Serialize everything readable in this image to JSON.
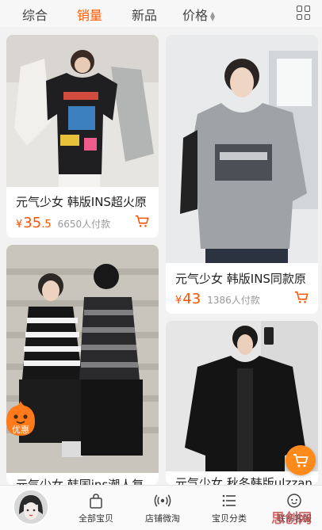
{
  "sort_bar": {
    "tabs": [
      "综合",
      "销量",
      "新品",
      "价格"
    ],
    "active_tab": "销量"
  },
  "products": [
    {
      "title": "元气少女 韩版INS超火原",
      "currency": "¥",
      "price_int": "35",
      "price_dec": ".5",
      "sold": "6650人付款"
    },
    {
      "title": "元气少女 韩版INS同款原",
      "currency": "¥",
      "price_int": "43",
      "price_dec": "",
      "sold": "1386人付款"
    },
    {
      "title": "元气少女 韩国ins潮人复",
      "currency": "",
      "price_int": "",
      "price_dec": "",
      "sold": ""
    },
    {
      "title": "元气少女 秋冬韩版ulzzan",
      "currency": "",
      "price_int": "",
      "price_dec": "",
      "sold": ""
    }
  ],
  "promo_badge": "优惠",
  "tab_bar": {
    "items": [
      "全部宝贝",
      "店铺微淘",
      "宝贝分类",
      "联系客服"
    ]
  },
  "watermark": "思创网",
  "colors": {
    "accent": "#ff5000",
    "active_tab": "#ff5a00",
    "fab": "#ff8a1c"
  }
}
